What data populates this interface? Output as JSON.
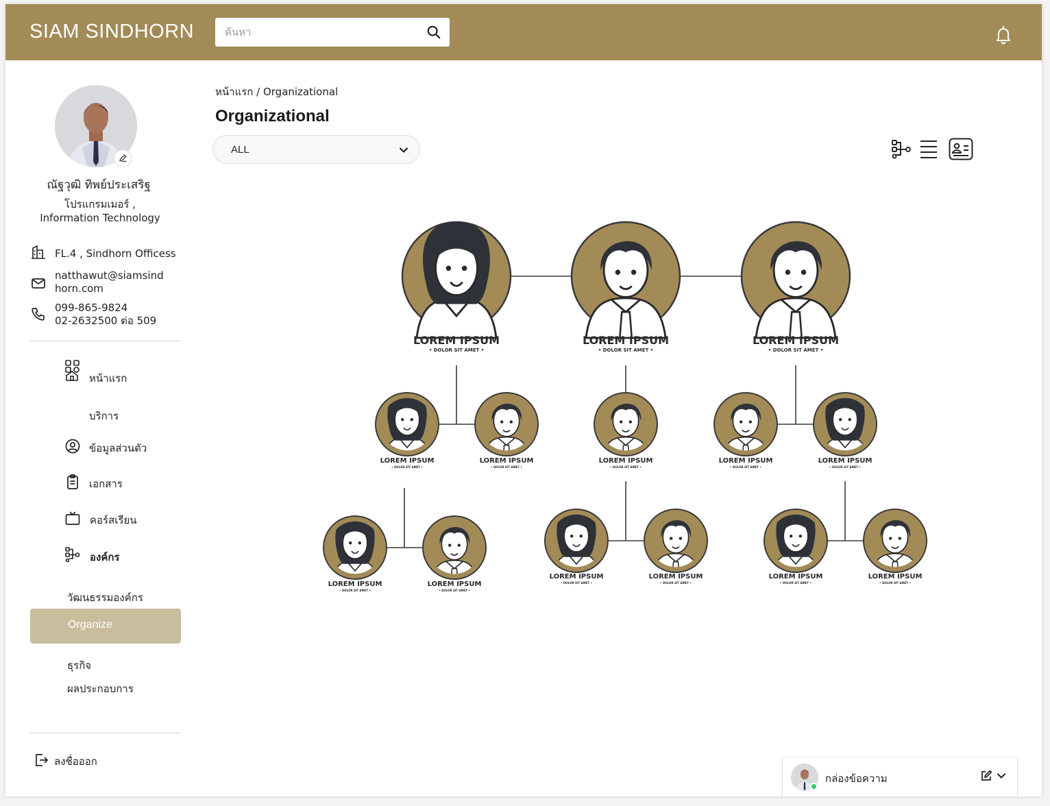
{
  "header": {
    "brand": "SIAM SINDHORN",
    "search_placeholder": "ค้นหา",
    "search_icon": "search-icon",
    "bell_icon": "bell-icon"
  },
  "profile": {
    "name": "ณัฐวุฒิ ทิพย์ประเสริฐ",
    "role_line1": "โปรแกรมเมอร์ ,",
    "role_line2": "Information Technology",
    "location": "FL.4 , Sindhorn Officess",
    "email_line1": "natthawut@siamsind",
    "email_line2": "horn.com",
    "phone_line1": "099-865-9824",
    "phone_line2": "02-2632500 ต่อ 509"
  },
  "nav": {
    "home": "หน้าแรก",
    "services": "บริการ",
    "personal": "ข้อมูลส่วนตัว",
    "documents": "เอกสาร",
    "courses": "คอร์สเรียน",
    "organization": "องค์กร",
    "culture": "วัฒนธรรมองค์กร",
    "organize": "Organize",
    "business": "ธุรกิจ",
    "performance": "ผลประกอบการ",
    "logout": "ลงชื่อออก"
  },
  "main": {
    "breadcrumb": "หน้าแรก / Organizational",
    "title": "Organizational",
    "filter_value": "ALL",
    "view_icons": [
      "org-chart-view-icon",
      "list-view-icon",
      "card-view-icon"
    ]
  },
  "org_chart": {
    "label": "LOREM IPSUM",
    "sub": "• DOLOR SIT AMET •",
    "accent": "#a38b58"
  },
  "messages": {
    "label": "กล่องข้อความ"
  },
  "colors": {
    "header_bg": "#a38b58",
    "active_nav_bg": "#c8bd9c",
    "online": "#2fd35b"
  }
}
